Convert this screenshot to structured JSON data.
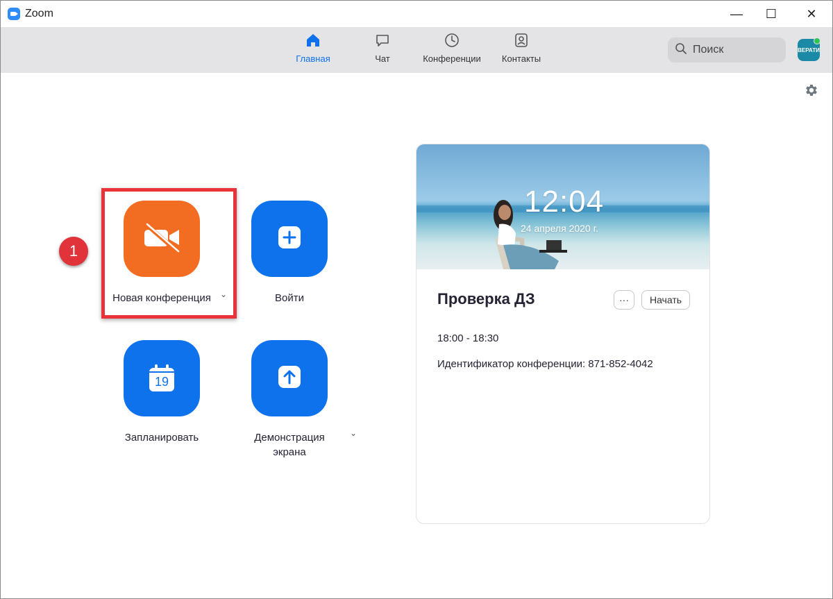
{
  "window": {
    "title": "Zoom",
    "minimize": "—",
    "maximize": "☐",
    "close": "✕"
  },
  "tabs": [
    {
      "label": "Главная",
      "icon": "home-icon",
      "active": true
    },
    {
      "label": "Чат",
      "icon": "chat-icon",
      "active": false
    },
    {
      "label": "Конференции",
      "icon": "clock-icon",
      "active": false
    },
    {
      "label": "Контакты",
      "icon": "contacts-icon",
      "active": false
    }
  ],
  "search": {
    "label": "Поиск"
  },
  "avatar": {
    "text": "ВЕРАТИ"
  },
  "actions": {
    "new_meeting": "Новая конференция",
    "join": "Войти",
    "schedule": "Запланировать",
    "schedule_day": "19",
    "share_line1": "Демонстрация",
    "share_line2": "экрана"
  },
  "annotation": {
    "step": "1"
  },
  "card": {
    "time": "12:04",
    "date": "24 апреля 2020 г.",
    "meeting_title": "Проверка ДЗ",
    "more_label": "···",
    "start_label": "Начать",
    "meeting_time": "18:00 - 18:30",
    "meeting_id": "Идентификатор конференции: 871-852-4042"
  },
  "colors": {
    "accent_blue": "#0e72ed",
    "orange": "#f26d21",
    "highlight_red": "#e8333a",
    "toolbar_bg": "#e4e4e7"
  }
}
